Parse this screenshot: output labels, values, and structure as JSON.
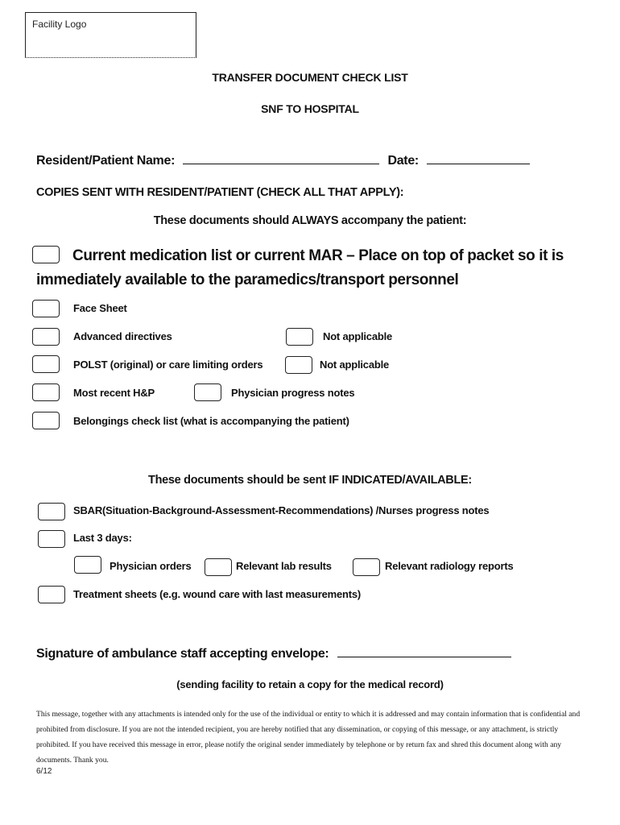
{
  "header": {
    "logo_placeholder": "Facility Logo",
    "title": "TRANSFER DOCUMENT CHECK LIST",
    "subtitle": "SNF TO HOSPITAL"
  },
  "fields": {
    "name_label": "Resident/Patient Name:",
    "name_value": "",
    "date_label": "Date:",
    "date_value": ""
  },
  "copies_heading": "COPIES SENT WITH RESIDENT/PATIENT (CHECK ALL THAT APPLY):",
  "always_section": {
    "heading": "These documents should ALWAYS accompany the patient:",
    "primary_item": "Current medication list or current MAR – Place on top of packet so it is immediately available to the paramedics/transport personnel",
    "items": [
      {
        "label": "Face Sheet",
        "checked": false
      },
      {
        "label": "Advanced directives",
        "checked": false,
        "alt_label": "Not applicable",
        "alt_checked": false
      },
      {
        "label": "POLST (original) or care limiting orders",
        "checked": false,
        "alt_label": "Not applicable",
        "alt_checked": false
      },
      {
        "label": "Most recent H&P",
        "checked": false,
        "alt_label": "Physician progress notes",
        "alt_checked": false
      },
      {
        "label": "Belongings check list (what is accompanying the patient)",
        "checked": false
      }
    ]
  },
  "indicated_section": {
    "heading": "These documents should be sent IF INDICATED/AVAILABLE:",
    "items": [
      {
        "label": "SBAR(Situation-Background-Assessment-Recommendations) /Nurses progress notes",
        "checked": false
      },
      {
        "label": "Last 3 days:",
        "checked": false
      },
      {
        "label": "Treatment sheets (e.g. wound care with last measurements)",
        "checked": false
      }
    ],
    "last3_subitems": [
      {
        "label": "Physician orders",
        "checked": false
      },
      {
        "label": "Relevant lab results",
        "checked": false
      },
      {
        "label": "Relevant radiology reports",
        "checked": false
      }
    ]
  },
  "signature": {
    "label": "Signature of ambulance staff accepting envelope:",
    "value": "",
    "note": "(sending facility to retain a copy for the medical record)"
  },
  "disclaimer": "This message, together with any attachments is intended only for the use of the individual or entity to which it is addressed and may contain information that is confidential and prohibited from disclosure.  If you are not the intended recipient, you are hereby notified that any dissemination, or copying of this message, or any attachment, is strictly prohibited.  If you have received this message in error, please notify the original sender immediately by telephone or by return fax and shred this document along with any documents. Thank you.",
  "version": "6/12"
}
